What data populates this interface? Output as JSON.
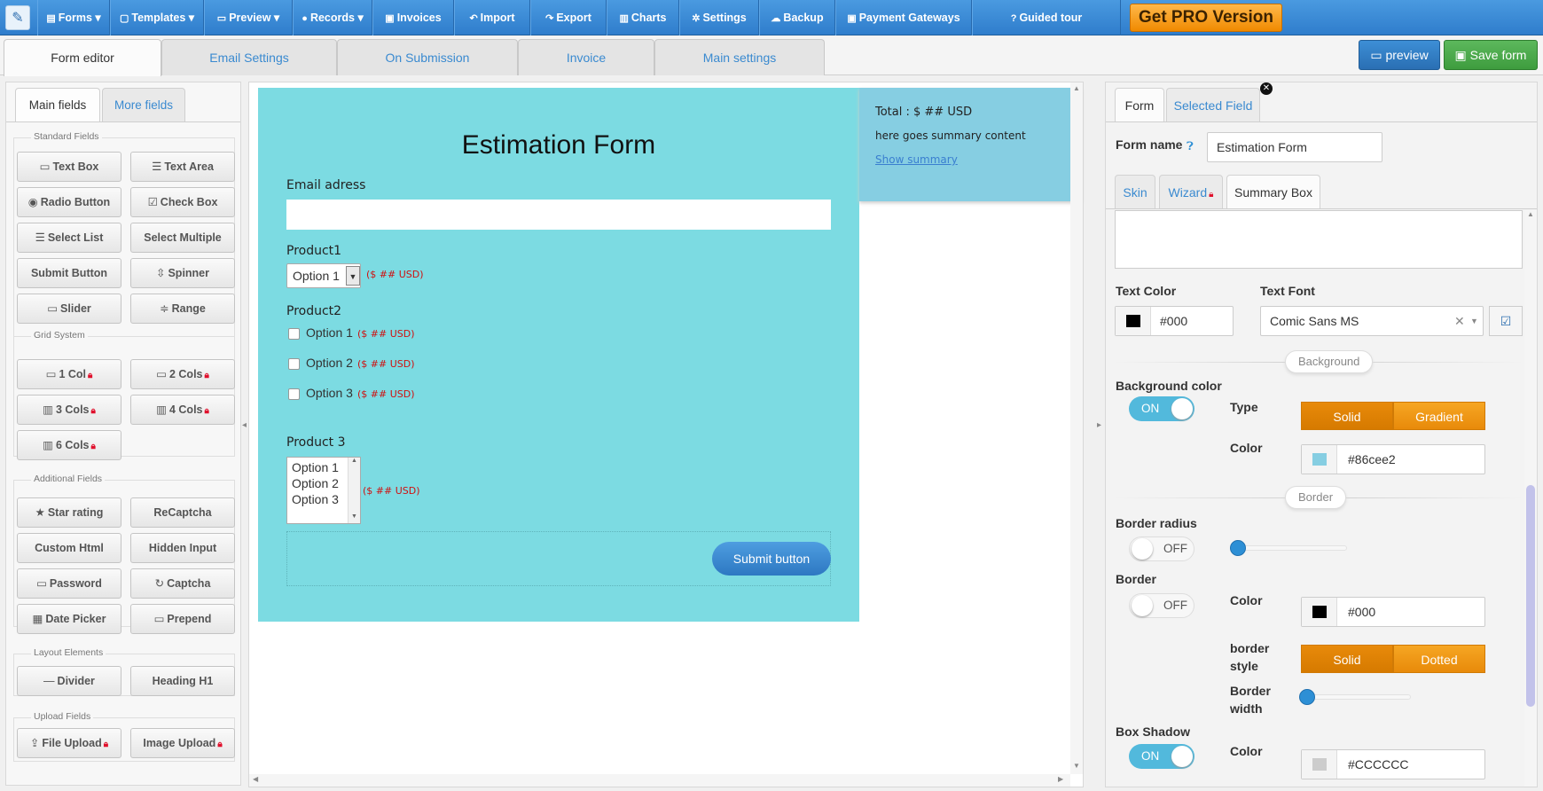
{
  "nav": {
    "items": [
      {
        "label": "Forms",
        "icon": "file-icon"
      },
      {
        "label": "Templates",
        "icon": "template-icon"
      },
      {
        "label": "Preview",
        "icon": "monitor-icon"
      },
      {
        "label": "Records",
        "icon": "help-circle-icon"
      },
      {
        "label": "Invoices",
        "icon": "invoice-icon"
      },
      {
        "label": "Import",
        "icon": "reply-icon"
      },
      {
        "label": "Export",
        "icon": "share-icon"
      },
      {
        "label": "Charts",
        "icon": "chart-icon"
      },
      {
        "label": "Settings",
        "icon": "gear-icon"
      },
      {
        "label": "Backup",
        "icon": "cloud-icon"
      },
      {
        "label": "Payment Gateways",
        "icon": "money-icon"
      },
      {
        "label": "Guided tour",
        "icon": "question-icon"
      }
    ],
    "pro_label": "Get PRO Version"
  },
  "tabs": {
    "form_editor": "Form editor",
    "email_settings": "Email Settings",
    "on_submission": "On Submission",
    "invoice": "Invoice",
    "main_settings": "Main settings",
    "preview_btn": "preview",
    "save_btn": "Save form"
  },
  "left": {
    "tab_main": "Main fields",
    "tab_more": "More fields",
    "standard_title": "Standard Fields",
    "standard": [
      "Text Box",
      "Text Area",
      "Radio Button",
      "Check Box",
      "Select List",
      "Select Multiple",
      "Submit Button",
      "Spinner",
      "Slider",
      "Range"
    ],
    "grid_title": "Grid System",
    "grid": [
      "1 Col",
      "2 Cols",
      "3 Cols",
      "4 Cols",
      "6 Cols"
    ],
    "additional_title": "Additional Fields",
    "additional": [
      "Star rating",
      "ReCaptcha",
      "Custom Html",
      "Hidden Input",
      "Password",
      "Captcha",
      "Date Picker",
      "Prepend"
    ],
    "layout_title": "Layout Elements",
    "layout": [
      "Divider",
      "Heading H1"
    ],
    "upload_title": "Upload Fields",
    "upload": [
      "File Upload",
      "Image Upload"
    ]
  },
  "form": {
    "title": "Estimation Form",
    "email_label": "Email adress",
    "product1_label": "Product1",
    "product1_select": "Option 1",
    "price": "($ ## USD)",
    "product2_label": "Product2",
    "product2_options": [
      "Option 1",
      "Option 2",
      "Option 3"
    ],
    "product3_label": "Product 3",
    "product3_options": [
      "Option 1",
      "Option 2",
      "Option 3"
    ],
    "submit_label": "Submit button",
    "bg_color": "#7cdbe2"
  },
  "summary": {
    "total": "Total : $ ## USD",
    "content": "here goes summary content",
    "link": "Show summary",
    "bg_color": "#86cee2"
  },
  "right": {
    "tab_form": "Form",
    "tab_selected": "Selected Field",
    "form_name_label": "Form name",
    "form_name_value": "Estimation Form",
    "sub_skin": "Skin",
    "sub_wizard": "Wizard",
    "sub_summary": "Summary Box",
    "text_color_label": "Text Color",
    "text_color_value": "#000",
    "text_font_label": "Text Font",
    "text_font_value": "Comic Sans MS",
    "background_pill": "Background",
    "bg_color_label": "Background color",
    "bg_toggle": "ON",
    "type_label": "Type",
    "type_solid": "Solid",
    "type_gradient": "Gradient",
    "color_label": "Color",
    "bg_color_value": "#86cee2",
    "border_pill": "Border",
    "border_radius_label": "Border radius",
    "border_radius_toggle": "OFF",
    "border_radius_level": 0,
    "border_label": "Border",
    "border_toggle": "OFF",
    "border_color_value": "#000",
    "border_style_label": "border style",
    "border_style_solid": "Solid",
    "border_style_dotted": "Dotted",
    "border_width_label": "Border width",
    "border_width_level": 0,
    "box_shadow_label": "Box Shadow",
    "box_shadow_toggle": "ON",
    "shadow_color_value": "#CCCCCC"
  }
}
